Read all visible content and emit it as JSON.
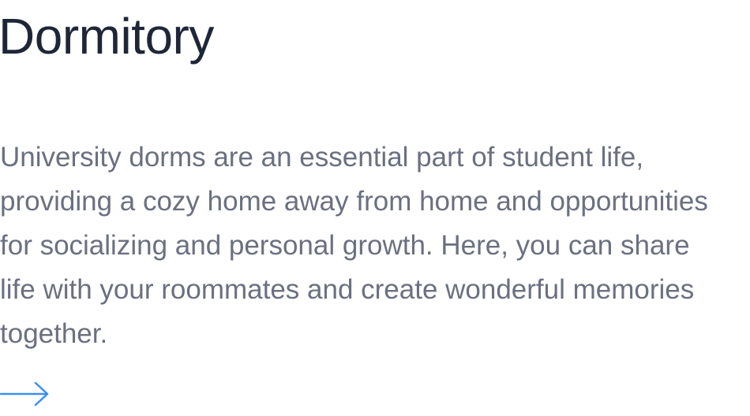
{
  "card": {
    "title": "Dormitory",
    "description_lines": [
      "University dorms are an essential part of student life,",
      "providing a cozy home away from home and opportunities",
      "for socializing and personal growth. Here, you can share",
      "life with your roommates and create wonderful memories",
      "together."
    ],
    "arrow_icon": "arrow-right-icon",
    "accent_color": "#3b8ff0",
    "title_color": "#1e2638",
    "text_color": "#6b7080"
  }
}
